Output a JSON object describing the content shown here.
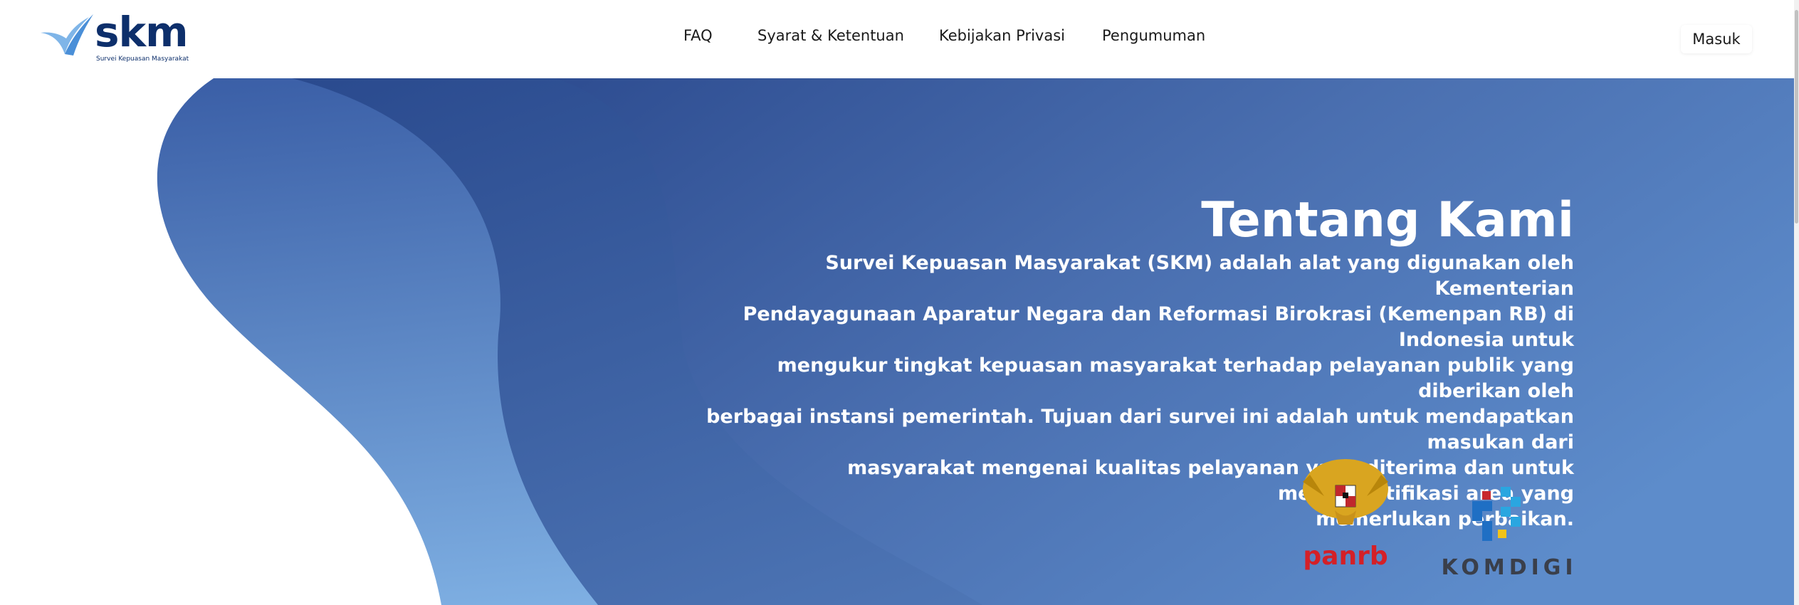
{
  "header": {
    "logo_text": "skm",
    "logo_subtitle": "Survei Kepuasan Masyarakat",
    "nav": [
      {
        "label": "FAQ"
      },
      {
        "label": "Syarat & Ketentuan"
      },
      {
        "label": "Kebijakan Privasi"
      },
      {
        "label": "Pengumuman"
      }
    ],
    "login_label": "Masuk"
  },
  "hero": {
    "title": "Tentang Kami",
    "lines": [
      "Survei Kepuasan Masyarakat (SKM) adalah alat yang digunakan oleh Kementerian",
      "Pendayagunaan Aparatur Negara dan Reformasi Birokrasi (Kemenpan RB) di Indonesia untuk",
      "mengukur tingkat kepuasan masyarakat terhadap pelayanan publik yang diberikan oleh",
      "berbagai instansi pemerintah. Tujuan dari survei ini adalah untuk mendapatkan masukan dari",
      "masyarakat mengenai kualitas pelayanan yang diterima dan untuk mengidentifikasi area yang",
      "memerlukan perbaikan."
    ]
  },
  "logos": {
    "panrb_text": "panrb",
    "komdigi_text": "KOMDIGI"
  },
  "colors": {
    "brand_navy": "#0d2f6b",
    "hero_dark": "#2f4f93",
    "hero_light": "#7fb0e3",
    "panrb_red": "#d42027"
  }
}
